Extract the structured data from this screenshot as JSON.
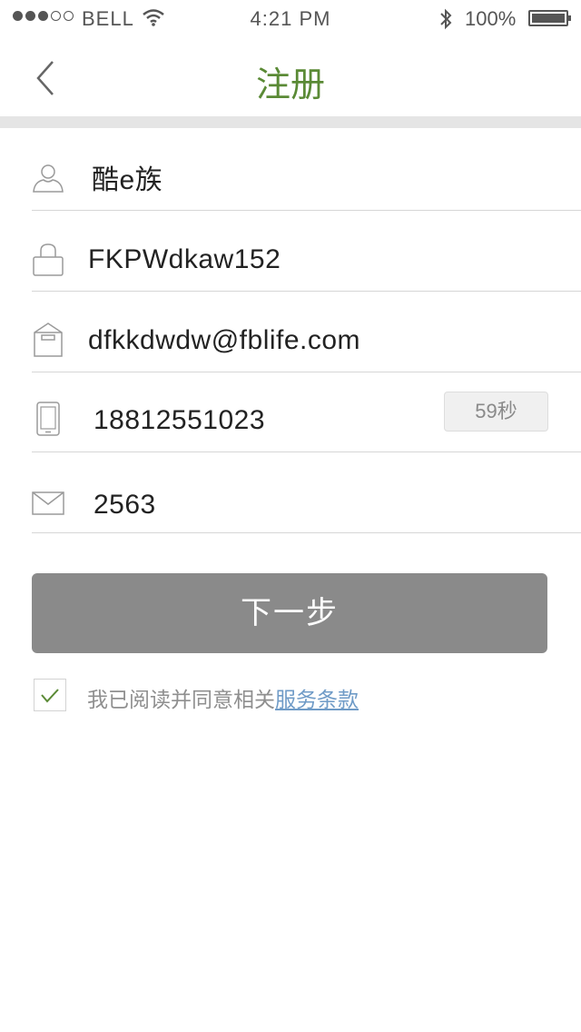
{
  "status_bar": {
    "carrier": "BELL",
    "signal_filled": 3,
    "signal_total": 5,
    "time": "4:21 PM",
    "battery": "100%",
    "icons": [
      "signal-dots-icon",
      "wifi-icon",
      "bluetooth-icon",
      "battery-icon"
    ]
  },
  "nav": {
    "title": "注册",
    "back_icon": "chevron-left-icon"
  },
  "form": {
    "username": {
      "icon": "user-icon",
      "value": "酷e族"
    },
    "password": {
      "icon": "lock-icon",
      "value": "FKPWdkaw152"
    },
    "email": {
      "icon": "mailbox-icon",
      "value": "dfkkdwdw@fblife.com"
    },
    "phone": {
      "icon": "phone-icon",
      "value": "18812551023",
      "code_button": "59秒"
    },
    "code": {
      "icon": "envelope-icon",
      "value": "2563"
    }
  },
  "next_button": "下一步",
  "agreement": {
    "checked": true,
    "text": "我已阅读并同意相关",
    "link": "服务条款"
  },
  "colors": {
    "title": "#5a8a35",
    "check": "#5a8a35",
    "button": "#8a8a8a",
    "link": "#6f9bc7",
    "divider": "#e5e5e5"
  }
}
